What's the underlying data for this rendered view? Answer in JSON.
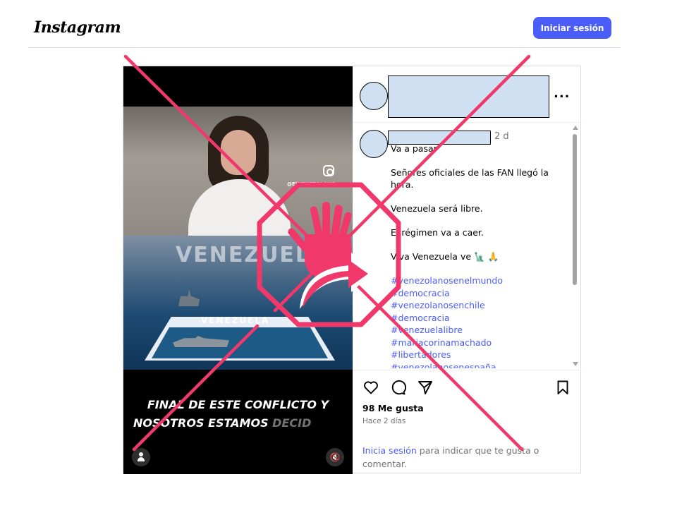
{
  "header": {
    "logo_text": "Instagram",
    "login_button": "Iniciar sesión"
  },
  "media": {
    "watermark_handle": "@ELVENEZOLANO",
    "sea_title": "VENEZUELA",
    "board_title": "VENEZUELA",
    "caption_line1": "FINAL DE ESTE CONFLICTO Y",
    "caption_line2_visible": "NOSOTROS ESTAMOS ",
    "caption_line2_faded": "DECID"
  },
  "post": {
    "more_label": "...",
    "time_ago": "2 d",
    "comment_lines": [
      "Va a pasar",
      "",
      "Señores oficiales de las FAN llegó la hora.",
      "",
      "Venezuela será libre.",
      "",
      "El régimen va a caer.",
      "",
      "Viva Venezuela ve 🗽 🙏"
    ],
    "hashtags": [
      "#venezolanosenelmundo",
      "#democracia",
      "#venezolanosenchile",
      "#democracia",
      "#venezuelalibre",
      "#mariacorinamachado",
      "#libertadores",
      "#venezolanosenespaña"
    ],
    "likes": "98 Me gusta",
    "date": "Hace 2 días",
    "login_link": "Inicia sesión",
    "login_rest": " para indicar que te gusta o comentar."
  },
  "colors": {
    "accent": "#4a5df9",
    "overlay_pink": "#f0386b",
    "redaction_fill": "#cfe0f3"
  },
  "icons": [
    "heart-icon",
    "comment-icon",
    "share-icon",
    "bookmark-icon",
    "user-icon",
    "mute-icon",
    "instagram-icon",
    "stop-hand-share-icon"
  ]
}
